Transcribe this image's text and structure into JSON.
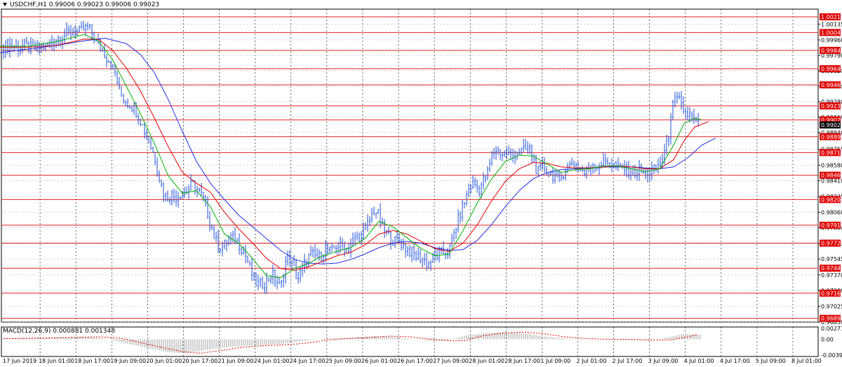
{
  "header": {
    "symbol": "USDCHF,H1",
    "ohlc": "0.99006 0.99023 0.99006 0.99023"
  },
  "macd": {
    "label": "MACD(12,26,9) 0.000881 0.001348",
    "axis_labels": [
      "0.002712",
      "0.00",
      "-0.003939"
    ]
  },
  "price_axis": {
    "tick_labels": [
      "1.00135",
      "0.99960",
      "0.99790",
      "0.99620",
      "0.99450",
      "0.99280",
      "0.99110",
      "0.98940",
      "0.98755",
      "0.98580",
      "0.98410",
      "0.98235",
      "0.98060",
      "0.97890",
      "0.97715",
      "0.97545",
      "0.97370",
      "0.97200",
      "0.97025",
      "0.96850"
    ],
    "current_price": "0.99023",
    "level_labels": [
      "1.00215",
      "1.00042",
      "0.99845",
      "0.99643",
      "0.99465",
      "0.99233",
      "0.99079",
      "0.98894",
      "0.98719",
      "0.98469",
      "0.98201",
      "0.97918",
      "0.97720",
      "0.97444",
      "0.97169",
      "0.96891"
    ]
  },
  "time_axis": {
    "labels": [
      "17 Jun 2019",
      "18 Jun 01:00",
      "18 Jun 17:00",
      "19 Jun 09:00",
      "20 Jun 01:00",
      "20 Jun 17:00",
      "21 Jun 09:00",
      "24 Jun 01:00",
      "24 Jun 17:00",
      "25 Jun 09:00",
      "26 Jun 01:00",
      "26 Jun 17:00",
      "27 Jun 09:00",
      "28 Jun 01:00",
      "28 Jun 17:00",
      "1 Jul 09:00",
      "2 Jul 01:00",
      "2 Jul 17:00",
      "3 Jul 09:00",
      "4 Jul 01:00",
      "4 Jul 17:00",
      "5 Jul 09:00",
      "8 Jul 01:00"
    ]
  },
  "colors": {
    "candle": "#1f4fd6",
    "level_line": "#e02020",
    "level_label_bg": "#e00000",
    "ma_fast": "#00b000",
    "ma_mid": "#e00000",
    "ma_slow": "#2030e0",
    "grid": "#b0b0b0"
  },
  "chart_data": {
    "type": "candlestick",
    "symbol": "USDCHF",
    "timeframe": "H1",
    "ylim": [
      0.9685,
      1.003
    ],
    "close_path": [
      [
        0,
        0.999
      ],
      [
        8,
        0.9988
      ],
      [
        16,
        0.9991
      ],
      [
        24,
        0.9987
      ],
      [
        32,
        0.9989
      ],
      [
        40,
        0.9988
      ],
      [
        48,
        0.9986
      ],
      [
        56,
        0.9988
      ],
      [
        64,
        0.9989
      ],
      [
        72,
        0.9992
      ],
      [
        80,
        0.9997
      ],
      [
        88,
        1.0
      ],
      [
        96,
        1.0003
      ],
      [
        104,
        1.0006
      ],
      [
        112,
        1.0004
      ],
      [
        120,
        1.0008
      ],
      [
        126,
        1.001
      ],
      [
        132,
        1.0002
      ],
      [
        140,
        0.999
      ],
      [
        148,
        0.9982
      ],
      [
        156,
        0.9972
      ],
      [
        164,
        0.996
      ],
      [
        170,
        0.994
      ],
      [
        176,
        0.9932
      ],
      [
        182,
        0.9926
      ],
      [
        190,
        0.9922
      ],
      [
        196,
        0.9915
      ],
      [
        204,
        0.99
      ],
      [
        212,
        0.9885
      ],
      [
        220,
        0.9868
      ],
      [
        226,
        0.9848
      ],
      [
        232,
        0.983
      ],
      [
        238,
        0.9822
      ],
      [
        244,
        0.9826
      ],
      [
        250,
        0.9823
      ],
      [
        256,
        0.9826
      ],
      [
        262,
        0.9828
      ],
      [
        268,
        0.983
      ],
      [
        274,
        0.9838
      ],
      [
        280,
        0.9832
      ],
      [
        286,
        0.9826
      ],
      [
        292,
        0.9818
      ],
      [
        298,
        0.9798
      ],
      [
        304,
        0.9782
      ],
      [
        310,
        0.977
      ],
      [
        316,
        0.9768
      ],
      [
        322,
        0.9772
      ],
      [
        328,
        0.9778
      ],
      [
        334,
        0.9776
      ],
      [
        340,
        0.9772
      ],
      [
        346,
        0.9764
      ],
      [
        352,
        0.9755
      ],
      [
        358,
        0.974
      ],
      [
        364,
        0.9728
      ],
      [
        370,
        0.9726
      ],
      [
        376,
        0.9728
      ],
      [
        382,
        0.9732
      ],
      [
        388,
        0.9738
      ],
      [
        394,
        0.973
      ],
      [
        400,
        0.9722
      ],
      [
        406,
        0.975
      ],
      [
        412,
        0.9756
      ],
      [
        418,
        0.9746
      ],
      [
        424,
        0.9732
      ],
      [
        430,
        0.9742
      ],
      [
        436,
        0.9752
      ],
      [
        442,
        0.976
      ],
      [
        448,
        0.9758
      ],
      [
        456,
        0.9756
      ],
      [
        464,
        0.9766
      ],
      [
        472,
        0.9762
      ],
      [
        480,
        0.977
      ],
      [
        488,
        0.9768
      ],
      [
        496,
        0.9766
      ],
      [
        504,
        0.9776
      ],
      [
        512,
        0.978
      ],
      [
        520,
        0.9786
      ],
      [
        526,
        0.9796
      ],
      [
        532,
        0.9808
      ],
      [
        538,
        0.9806
      ],
      [
        544,
        0.979
      ],
      [
        550,
        0.9784
      ],
      [
        556,
        0.9778
      ],
      [
        562,
        0.9774
      ],
      [
        568,
        0.9776
      ],
      [
        574,
        0.977
      ],
      [
        580,
        0.9765
      ],
      [
        586,
        0.9762
      ],
      [
        592,
        0.9758
      ],
      [
        598,
        0.9756
      ],
      [
        604,
        0.9754
      ],
      [
        610,
        0.9748
      ],
      [
        616,
        0.9755
      ],
      [
        622,
        0.9758
      ],
      [
        628,
        0.976
      ],
      [
        634,
        0.9763
      ],
      [
        640,
        0.9762
      ],
      [
        646,
        0.978
      ],
      [
        652,
        0.9795
      ],
      [
        658,
        0.981
      ],
      [
        664,
        0.9822
      ],
      [
        670,
        0.9836
      ],
      [
        676,
        0.9838
      ],
      [
        682,
        0.983
      ],
      [
        688,
        0.984
      ],
      [
        694,
        0.9846
      ],
      [
        700,
        0.9866
      ],
      [
        706,
        0.9876
      ],
      [
        712,
        0.9872
      ],
      [
        718,
        0.987
      ],
      [
        724,
        0.9871
      ],
      [
        730,
        0.9868
      ],
      [
        736,
        0.9872
      ],
      [
        742,
        0.9874
      ],
      [
        748,
        0.9874
      ],
      [
        754,
        0.9878
      ],
      [
        760,
        0.9866
      ],
      [
        764,
        0.9854
      ],
      [
        768,
        0.985
      ],
      [
        774,
        0.9856
      ],
      [
        780,
        0.9852
      ],
      [
        786,
        0.9848
      ],
      [
        792,
        0.9846
      ],
      [
        798,
        0.984
      ],
      [
        804,
        0.9852
      ],
      [
        810,
        0.9856
      ],
      [
        816,
        0.9862
      ],
      [
        822,
        0.9858
      ],
      [
        828,
        0.9854
      ],
      [
        834,
        0.9848
      ],
      [
        840,
        0.9856
      ],
      [
        846,
        0.986
      ],
      [
        852,
        0.9856
      ],
      [
        858,
        0.986
      ],
      [
        864,
        0.9862
      ],
      [
        870,
        0.986
      ],
      [
        876,
        0.9858
      ],
      [
        882,
        0.9854
      ],
      [
        888,
        0.9856
      ],
      [
        894,
        0.9852
      ],
      [
        900,
        0.9852
      ],
      [
        906,
        0.985
      ],
      [
        912,
        0.9852
      ],
      [
        918,
        0.9848
      ],
      [
        924,
        0.985
      ],
      [
        930,
        0.9852
      ],
      [
        936,
        0.9854
      ],
      [
        940,
        0.986
      ],
      [
        944,
        0.9866
      ],
      [
        948,
        0.9875
      ],
      [
        952,
        0.9885
      ],
      [
        956,
        0.9915
      ],
      [
        960,
        0.9926
      ],
      [
        964,
        0.993
      ],
      [
        968,
        0.9928
      ],
      [
        972,
        0.9922
      ],
      [
        976,
        0.9916
      ],
      [
        980,
        0.9914
      ],
      [
        984,
        0.9912
      ],
      [
        988,
        0.9908
      ],
      [
        992,
        0.9904
      ],
      [
        996,
        0.9902
      ]
    ],
    "ma_fast_path": [
      [
        0,
        0.9989
      ],
      [
        40,
        0.9989
      ],
      [
        80,
        0.9994
      ],
      [
        120,
        1.0002
      ],
      [
        140,
        0.9995
      ],
      [
        160,
        0.9975
      ],
      [
        180,
        0.9945
      ],
      [
        200,
        0.9915
      ],
      [
        220,
        0.9882
      ],
      [
        240,
        0.9846
      ],
      [
        260,
        0.9827
      ],
      [
        280,
        0.983
      ],
      [
        300,
        0.9812
      ],
      [
        320,
        0.9782
      ],
      [
        340,
        0.9772
      ],
      [
        360,
        0.9755
      ],
      [
        380,
        0.9736
      ],
      [
        400,
        0.9734
      ],
      [
        420,
        0.9744
      ],
      [
        440,
        0.975
      ],
      [
        460,
        0.9758
      ],
      [
        480,
        0.9763
      ],
      [
        500,
        0.9767
      ],
      [
        520,
        0.9777
      ],
      [
        540,
        0.9796
      ],
      [
        560,
        0.979
      ],
      [
        580,
        0.9778
      ],
      [
        600,
        0.9766
      ],
      [
        620,
        0.9758
      ],
      [
        640,
        0.976
      ],
      [
        660,
        0.9786
      ],
      [
        680,
        0.9816
      ],
      [
        700,
        0.9842
      ],
      [
        720,
        0.9862
      ],
      [
        740,
        0.9869
      ],
      [
        760,
        0.9868
      ],
      [
        780,
        0.9859
      ],
      [
        800,
        0.985
      ],
      [
        820,
        0.9853
      ],
      [
        840,
        0.9854
      ],
      [
        860,
        0.9857
      ],
      [
        880,
        0.9857
      ],
      [
        900,
        0.9854
      ],
      [
        920,
        0.9851
      ],
      [
        940,
        0.9854
      ],
      [
        960,
        0.988
      ],
      [
        975,
        0.9904
      ],
      [
        990,
        0.991
      ],
      [
        1000,
        0.9908
      ]
    ],
    "ma_mid_path": [
      [
        0,
        0.9988
      ],
      [
        40,
        0.9988
      ],
      [
        80,
        0.999
      ],
      [
        120,
        0.9997
      ],
      [
        140,
        0.9997
      ],
      [
        160,
        0.9985
      ],
      [
        180,
        0.9965
      ],
      [
        200,
        0.994
      ],
      [
        220,
        0.991
      ],
      [
        240,
        0.9878
      ],
      [
        260,
        0.985
      ],
      [
        280,
        0.9838
      ],
      [
        300,
        0.9828
      ],
      [
        320,
        0.9806
      ],
      [
        340,
        0.9788
      ],
      [
        360,
        0.9772
      ],
      [
        380,
        0.9755
      ],
      [
        400,
        0.9744
      ],
      [
        420,
        0.9742
      ],
      [
        440,
        0.9746
      ],
      [
        460,
        0.9752
      ],
      [
        480,
        0.9758
      ],
      [
        500,
        0.9762
      ],
      [
        520,
        0.977
      ],
      [
        540,
        0.9782
      ],
      [
        560,
        0.9786
      ],
      [
        580,
        0.9782
      ],
      [
        600,
        0.9774
      ],
      [
        620,
        0.9766
      ],
      [
        640,
        0.9763
      ],
      [
        660,
        0.9772
      ],
      [
        680,
        0.9792
      ],
      [
        700,
        0.9818
      ],
      [
        720,
        0.984
      ],
      [
        740,
        0.9854
      ],
      [
        760,
        0.9861
      ],
      [
        780,
        0.986
      ],
      [
        800,
        0.9856
      ],
      [
        820,
        0.9855
      ],
      [
        840,
        0.9855
      ],
      [
        860,
        0.9856
      ],
      [
        880,
        0.9857
      ],
      [
        900,
        0.9856
      ],
      [
        920,
        0.9854
      ],
      [
        940,
        0.9854
      ],
      [
        960,
        0.9864
      ],
      [
        975,
        0.9885
      ],
      [
        990,
        0.99
      ],
      [
        1010,
        0.9906
      ]
    ],
    "ma_slow_path": [
      [
        0,
        0.9982
      ],
      [
        40,
        0.9986
      ],
      [
        80,
        0.999
      ],
      [
        120,
        0.9995
      ],
      [
        150,
        0.9998
      ],
      [
        180,
        0.9992
      ],
      [
        200,
        0.998
      ],
      [
        220,
        0.996
      ],
      [
        240,
        0.993
      ],
      [
        260,
        0.9895
      ],
      [
        280,
        0.9862
      ],
      [
        300,
        0.9838
      ],
      [
        320,
        0.982
      ],
      [
        340,
        0.9803
      ],
      [
        360,
        0.979
      ],
      [
        380,
        0.9777
      ],
      [
        400,
        0.9764
      ],
      [
        420,
        0.9754
      ],
      [
        440,
        0.975
      ],
      [
        460,
        0.9749
      ],
      [
        480,
        0.975
      ],
      [
        500,
        0.9754
      ],
      [
        520,
        0.976
      ],
      [
        540,
        0.9767
      ],
      [
        560,
        0.9772
      ],
      [
        580,
        0.9774
      ],
      [
        600,
        0.9772
      ],
      [
        620,
        0.9767
      ],
      [
        640,
        0.9764
      ],
      [
        660,
        0.9765
      ],
      [
        680,
        0.9775
      ],
      [
        700,
        0.9792
      ],
      [
        720,
        0.9812
      ],
      [
        740,
        0.983
      ],
      [
        760,
        0.9843
      ],
      [
        780,
        0.985
      ],
      [
        800,
        0.9853
      ],
      [
        820,
        0.9854
      ],
      [
        840,
        0.9855
      ],
      [
        860,
        0.9856
      ],
      [
        880,
        0.9856
      ],
      [
        900,
        0.9856
      ],
      [
        920,
        0.9855
      ],
      [
        940,
        0.9854
      ],
      [
        960,
        0.9856
      ],
      [
        980,
        0.9866
      ],
      [
        1000,
        0.988
      ],
      [
        1020,
        0.9888
      ]
    ],
    "macd_path": [
      [
        0,
        0.0002
      ],
      [
        60,
        0.0004
      ],
      [
        120,
        0.0006
      ],
      [
        150,
        0.0002
      ],
      [
        180,
        -0.001
      ],
      [
        210,
        -0.0022
      ],
      [
        240,
        -0.0032
      ],
      [
        260,
        -0.0035
      ],
      [
        290,
        -0.0028
      ],
      [
        320,
        -0.002
      ],
      [
        350,
        -0.0016
      ],
      [
        380,
        -0.0014
      ],
      [
        410,
        -0.001
      ],
      [
        440,
        -0.0002
      ],
      [
        470,
        0.0002
      ],
      [
        500,
        0.0004
      ],
      [
        530,
        0.0008
      ],
      [
        560,
        0.0006
      ],
      [
        590,
        0.0
      ],
      [
        620,
        -0.0004
      ],
      [
        640,
        -0.0003
      ],
      [
        660,
        0.0008
      ],
      [
        690,
        0.0015
      ],
      [
        720,
        0.0018
      ],
      [
        750,
        0.0014
      ],
      [
        780,
        0.0006
      ],
      [
        810,
        0.0002
      ],
      [
        840,
        0.0
      ],
      [
        870,
        0.0
      ],
      [
        900,
        -0.0002
      ],
      [
        930,
        -0.0002
      ],
      [
        955,
        0.0006
      ],
      [
        975,
        0.0014
      ],
      [
        1000,
        0.0011
      ]
    ]
  }
}
